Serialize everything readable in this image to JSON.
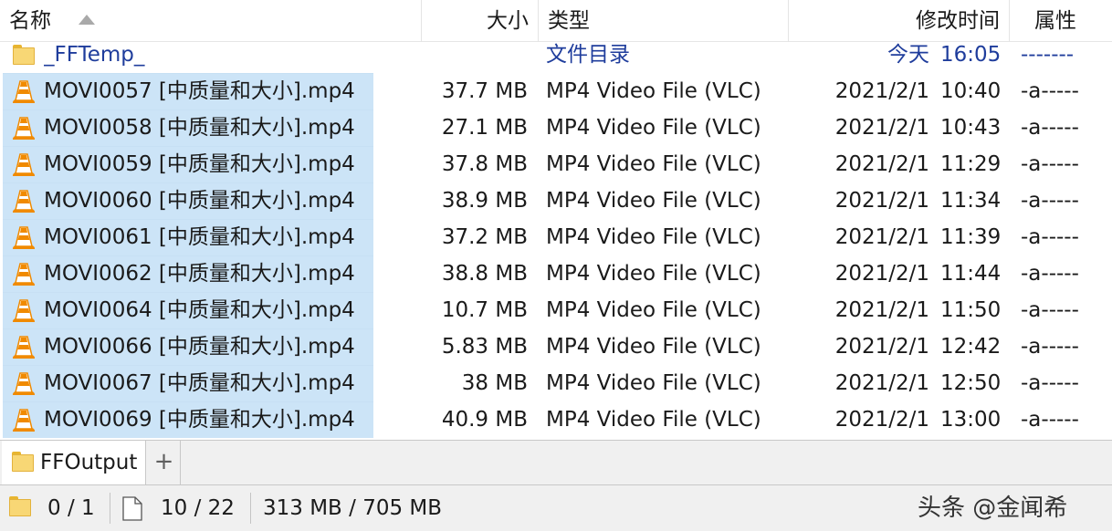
{
  "header": {
    "name": "名称",
    "size": "大小",
    "type": "类型",
    "modified": "修改时间",
    "attributes": "属性"
  },
  "folder_row": {
    "name": "_FFTemp_",
    "type": "文件目录",
    "date": "今天",
    "time": "16:05",
    "attr": "-------"
  },
  "files": [
    {
      "name": "MOVI0057 [中质量和大小].mp4",
      "size": "37.7 MB",
      "type": "MP4 Video File (VLC)",
      "date": "2021/2/1",
      "time": "10:40",
      "attr": "-a-----"
    },
    {
      "name": "MOVI0058 [中质量和大小].mp4",
      "size": "27.1 MB",
      "type": "MP4 Video File (VLC)",
      "date": "2021/2/1",
      "time": "10:43",
      "attr": "-a-----"
    },
    {
      "name": "MOVI0059 [中质量和大小].mp4",
      "size": "37.8 MB",
      "type": "MP4 Video File (VLC)",
      "date": "2021/2/1",
      "time": "11:29",
      "attr": "-a-----"
    },
    {
      "name": "MOVI0060 [中质量和大小].mp4",
      "size": "38.9 MB",
      "type": "MP4 Video File (VLC)",
      "date": "2021/2/1",
      "time": "11:34",
      "attr": "-a-----"
    },
    {
      "name": "MOVI0061 [中质量和大小].mp4",
      "size": "37.2 MB",
      "type": "MP4 Video File (VLC)",
      "date": "2021/2/1",
      "time": "11:39",
      "attr": "-a-----"
    },
    {
      "name": "MOVI0062 [中质量和大小].mp4",
      "size": "38.8 MB",
      "type": "MP4 Video File (VLC)",
      "date": "2021/2/1",
      "time": "11:44",
      "attr": "-a-----"
    },
    {
      "name": "MOVI0064 [中质量和大小].mp4",
      "size": "10.7 MB",
      "type": "MP4 Video File (VLC)",
      "date": "2021/2/1",
      "time": "11:50",
      "attr": "-a-----"
    },
    {
      "name": "MOVI0066 [中质量和大小].mp4",
      "size": "5.83 MB",
      "type": "MP4 Video File (VLC)",
      "date": "2021/2/1",
      "time": "12:42",
      "attr": "-a-----"
    },
    {
      "name": "MOVI0067 [中质量和大小].mp4",
      "size": "38 MB",
      "type": "MP4 Video File (VLC)",
      "date": "2021/2/1",
      "time": "12:50",
      "attr": "-a-----"
    },
    {
      "name": "MOVI0069 [中质量和大小].mp4",
      "size": "40.9 MB",
      "type": "MP4 Video File (VLC)",
      "date": "2021/2/1",
      "time": "13:00",
      "attr": "-a-----"
    }
  ],
  "tabs": [
    {
      "label": "FFOutput",
      "active": true
    }
  ],
  "tab_add_label": "+",
  "status": {
    "folders": "0 / 1",
    "files": "10 / 22",
    "size": "313 MB / 705 MB"
  },
  "watermark": "头条 @金闻希",
  "icons": {
    "folder": "folder-icon",
    "file": "vlc-cone-icon",
    "sort": "sort-ascending-icon"
  },
  "colors": {
    "selection": "#cce4f7",
    "directory_text": "#1f3d9c",
    "folder_yellow": "#f8d775",
    "vlc_orange": "#f08a00",
    "bar_gray": "#f0f0f0"
  }
}
